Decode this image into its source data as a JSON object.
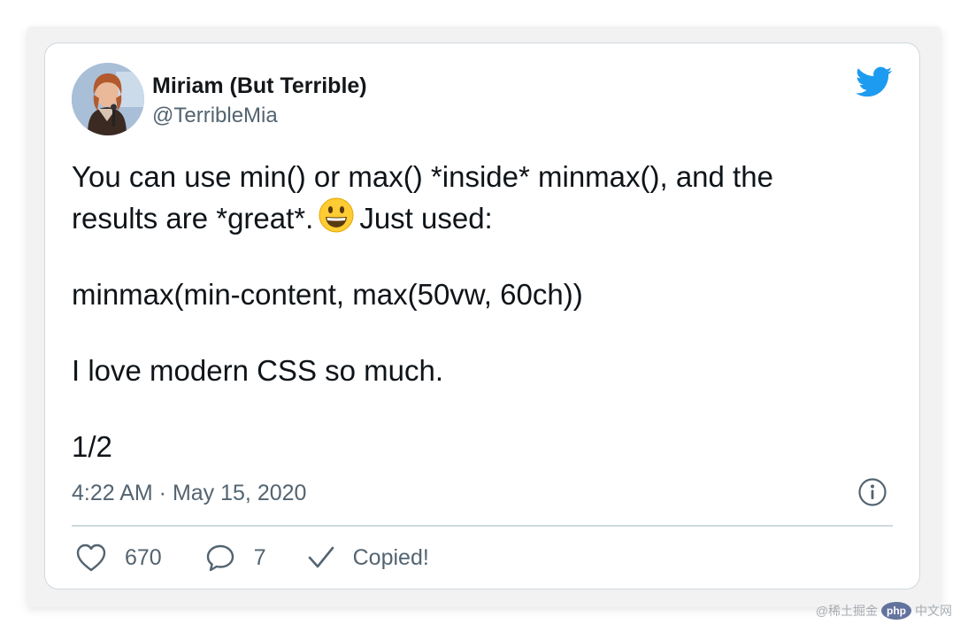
{
  "tweet": {
    "author": {
      "display_name": "Miriam (But Terrible)",
      "handle": "@TerribleMia",
      "avatar_icon": "profile-photo"
    },
    "brand_icon": "twitter-bird-icon",
    "brand_color": "#1d9bf0",
    "text": {
      "line1": "You can use min() or max() *inside* minmax(), and the",
      "line2_before_emoji": "results are *great*.",
      "emoji": "grinning-face-emoji",
      "line2_after_emoji": "Just used:",
      "line3": "minmax(min-content, max(50vw, 60ch))",
      "line4": "I love modern CSS so much.",
      "line5": "1/2"
    },
    "timestamp": "4:22 AM · May 15, 2020",
    "info_icon": "info-icon",
    "actions": {
      "likes": {
        "icon": "heart-icon",
        "count": "670"
      },
      "replies": {
        "icon": "reply-icon",
        "count": "7"
      },
      "copy": {
        "icon": "checkmark-icon",
        "label": "Copied!"
      }
    },
    "colors": {
      "text": "#0f1419",
      "secondary": "#536471",
      "border": "#cfd9de"
    }
  },
  "watermark": {
    "prefix": "@稀土掘金",
    "badge": "php",
    "suffix": "中文网"
  }
}
